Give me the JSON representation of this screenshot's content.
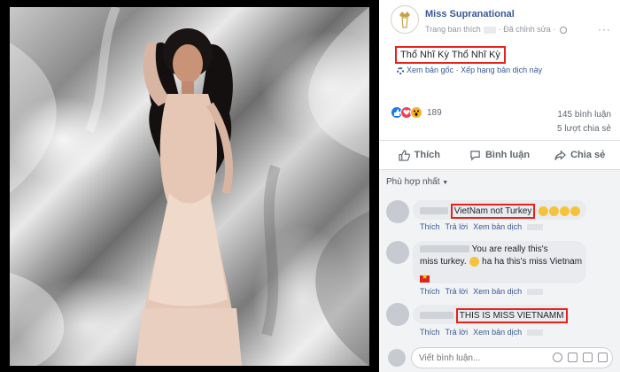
{
  "post": {
    "page_name": "Miss Supranational",
    "subtitle_prefix": "Trang ban thích",
    "edited": "Đã chỉnh sửa",
    "more": "···",
    "caption": "Thổ Nhĩ Kỳ Thổ Nhĩ Kỳ",
    "see_original": "Xem bản gốc",
    "rate_translation": "Xếp hạng bản dịch này",
    "translate_sep": "·",
    "reaction_count": "189",
    "comments_count": "145 bình luận",
    "shares_count": "5 lượt chia sẻ"
  },
  "actions": {
    "like": "Thích",
    "comment": "Bình luận",
    "share": "Chia sẻ"
  },
  "comments": {
    "sort_label": "Phù hợp nhất",
    "items": [
      {
        "text": "VietNam not Turkey"
      },
      {
        "text_line1": "You are really this's",
        "text_line2": "miss turkey.",
        "text_line2b": "ha ha this's miss Vietnam"
      },
      {
        "text": "THIS IS MISS VIETNAMM"
      }
    ],
    "meta": {
      "like": "Thích",
      "reply": "Trả lời",
      "translate": "Xem bản dịch",
      "dot": "·"
    }
  },
  "compose": {
    "placeholder": "Viết bình luận..."
  },
  "colors": {
    "link": "#385898",
    "highlight": "#e8221b",
    "like_blue": "#1877f2"
  }
}
